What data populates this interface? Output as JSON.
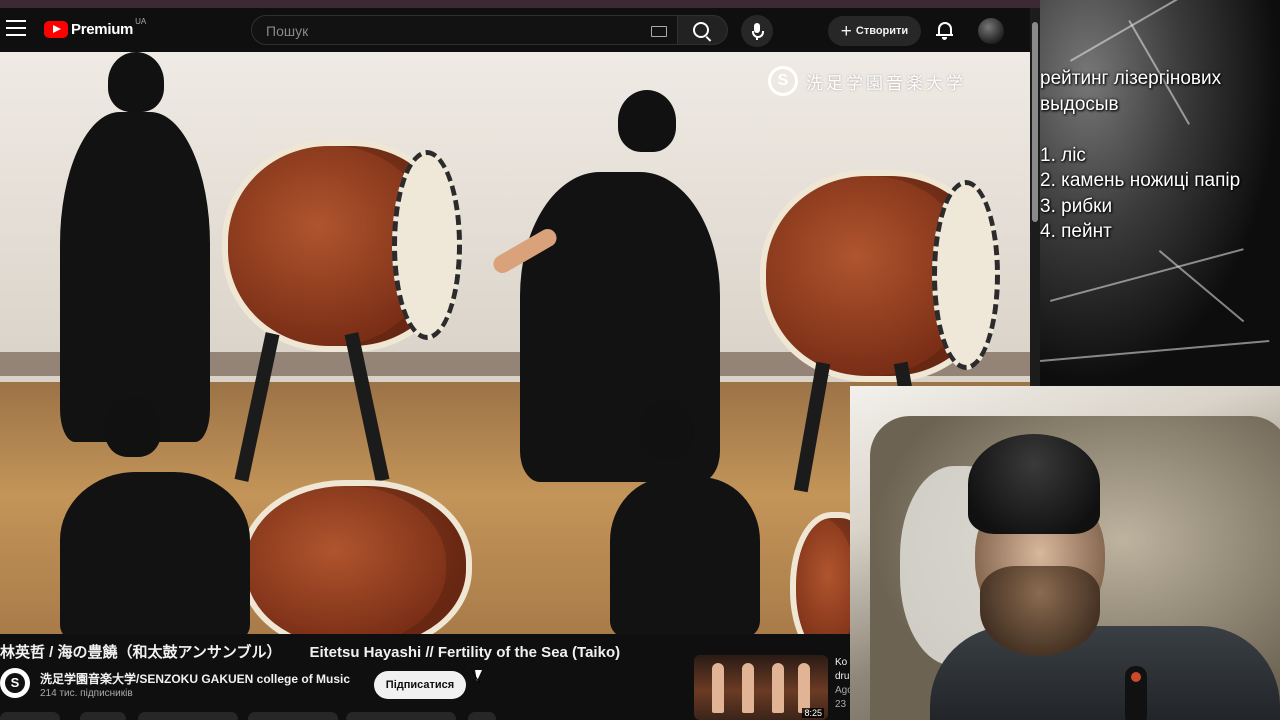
{
  "header": {
    "logo_text": "Premium",
    "country_code": "UA",
    "search_placeholder": "Пошук",
    "create_label": "Створити",
    "accent": "#ff0000"
  },
  "video": {
    "watermark_text": "洗足学園音楽大学",
    "watermark_symbol": "S",
    "title_jp": "林英哲 / 海の豊饒（和太鼓アンサンブル）",
    "title_en": "Eitetsu Hayashi // Fertility of the Sea (Taiko)"
  },
  "channel": {
    "avatar_symbol": "S",
    "name": "洗足学園音楽大学/SENZOKU GAKUEN college of Music",
    "subscribers": "214 тис. підписників",
    "subscribe_label": "Підписатися"
  },
  "recommendation": {
    "title_fragment_1": "Ko",
    "title_fragment_2": "dru",
    "channel_fragment": "Ago",
    "meta_fragment": "23",
    "duration": "8:25"
  },
  "overlay": {
    "text": "рейтинг лізергінових\nвыдосыв\n\n1. ліс\n2. камень ножиці папір\n3. рибки\n4. пейнт"
  },
  "icons": {
    "menu": "menu-icon",
    "search": "search-icon",
    "keyboard": "keyboard-icon",
    "mic": "mic-icon",
    "plus": "plus-icon",
    "bell": "bell-icon"
  }
}
